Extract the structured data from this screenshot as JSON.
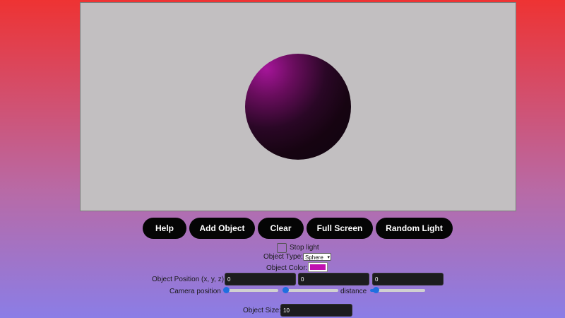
{
  "buttons": {
    "help": "Help",
    "add_object": "Add Object",
    "clear": "Clear",
    "full_screen": "Full Screen",
    "random_light": "Random Light"
  },
  "controls": {
    "stop_light_label": "Stop light",
    "stop_light_checked": false,
    "object_type_label": "Object Type:",
    "object_type_value": "Sphere",
    "object_color_label": "Object Color:",
    "object_color_value": "#c010b0",
    "object_position_label": "Object Position (x, y, z):",
    "position_x": "0",
    "position_y": "0",
    "position_z": "0",
    "camera_position_label": "Camera position",
    "distance_label": "distance",
    "object_size_label": "Object Size:",
    "object_size_value": "10"
  },
  "scene": {
    "background_color": "#c2bfc1",
    "object_shape": "sphere",
    "object_color": "#c010b0"
  }
}
